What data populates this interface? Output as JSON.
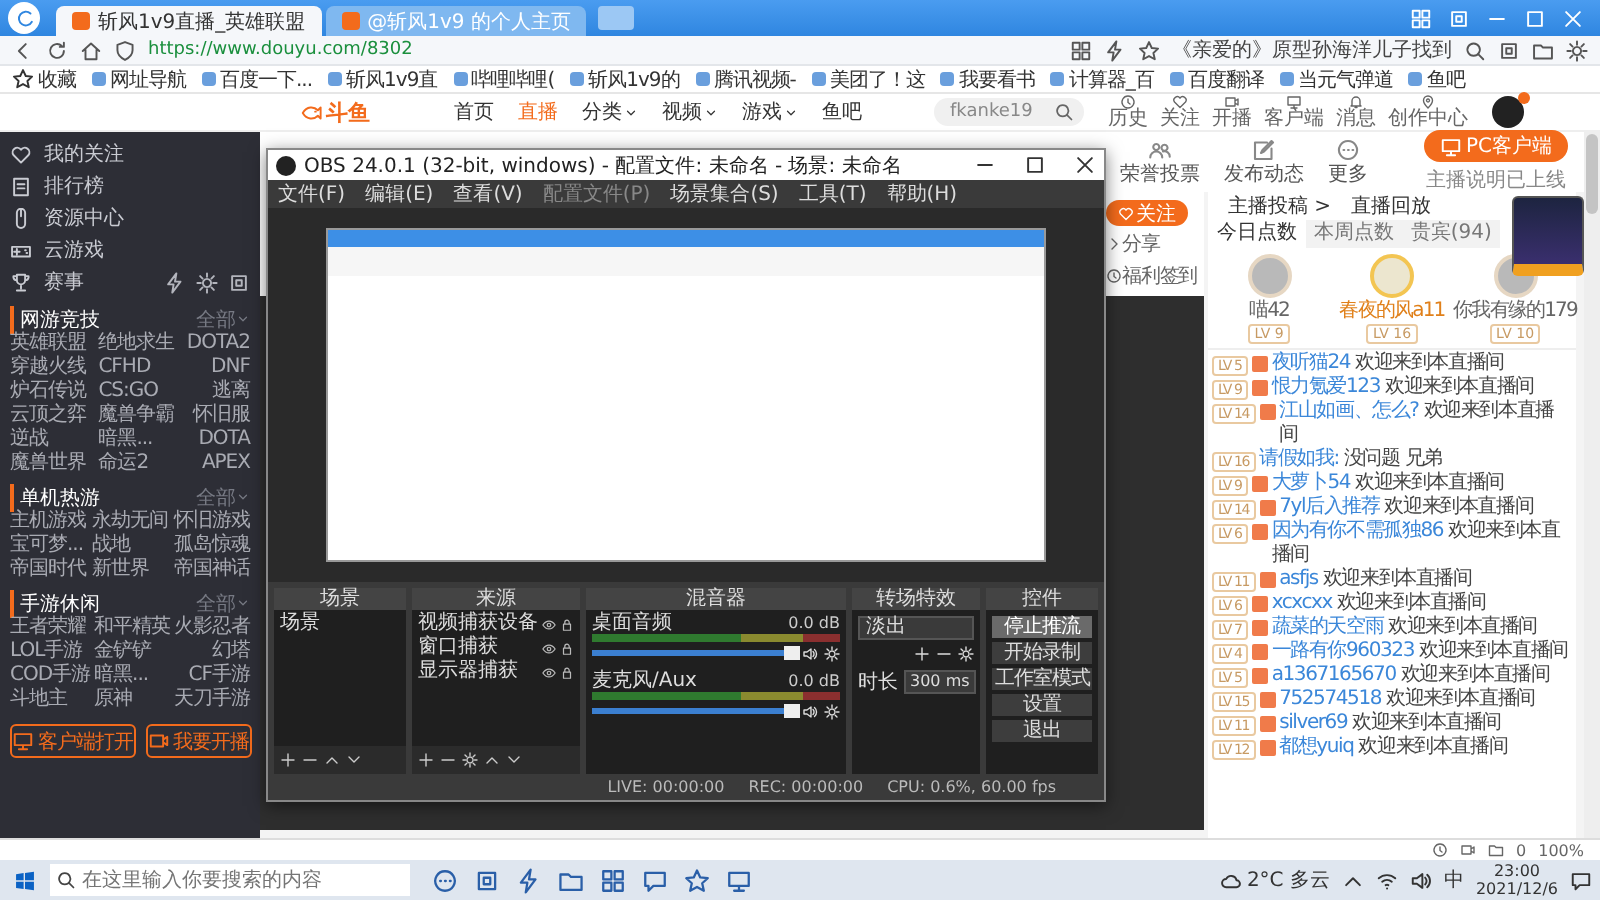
{
  "browser": {
    "tabs": [
      {
        "label": "斩风1v9直播_英雄联盟",
        "selected": true
      },
      {
        "label": "@斩风1v9 的个人主页",
        "selected": false
      }
    ],
    "url": "https://www.douyu.com/8302",
    "headline": "《亲爱的》原型孙海洋儿子找到",
    "bookmarks": [
      "收藏",
      "网址导航",
      "百度一下...",
      "斩风1v9直",
      "哔哩哔哩(",
      "斩风1v9的",
      "腾讯视频-",
      "美团了！这",
      "我要看书",
      "计算器_百",
      "百度翻译",
      "当元气弹道",
      "鱼吧"
    ],
    "status": {
      "count": "0",
      "zoom": "100%"
    }
  },
  "site": {
    "logo": "斗鱼",
    "links": [
      {
        "label": "首页",
        "selected": false,
        "dropdown": false
      },
      {
        "label": "直播",
        "selected": true,
        "dropdown": false
      },
      {
        "label": "分类",
        "selected": false,
        "dropdown": true
      },
      {
        "label": "视频",
        "selected": false,
        "dropdown": true
      },
      {
        "label": "游戏",
        "selected": false,
        "dropdown": true
      },
      {
        "label": "鱼吧",
        "selected": false,
        "dropdown": false
      }
    ],
    "search": {
      "value": "fkanke19"
    },
    "actions": [
      {
        "label": "历史",
        "kind": "clock"
      },
      {
        "label": "关注",
        "kind": "heart"
      },
      {
        "label": "开播",
        "kind": "camera"
      },
      {
        "label": "客户端",
        "kind": "monitor"
      },
      {
        "label": "消息",
        "kind": "bell"
      },
      {
        "label": "创作中心",
        "kind": "pin"
      }
    ]
  },
  "sidebar": {
    "items": [
      {
        "label": "我的关注",
        "kind": "heart"
      },
      {
        "label": "排行榜",
        "kind": "list"
      },
      {
        "label": "资源中心",
        "kind": "mouse"
      },
      {
        "label": "云游戏",
        "kind": "gamepad"
      },
      {
        "label": "赛事",
        "kind": "trophy"
      }
    ],
    "sections": [
      {
        "title": "网游竞技",
        "more": "全部",
        "games": [
          "英雄联盟",
          "绝地求生",
          "DOTA2",
          "穿越火线",
          "CFHD",
          "DNF",
          "炉石传说",
          "CS:GO",
          "逃离",
          "云顶之弈",
          "魔兽争霸",
          "怀旧服",
          "逆战",
          "暗黑...",
          "DOTA",
          "魔兽世界",
          "命运2",
          "APEX"
        ]
      },
      {
        "title": "单机热游",
        "more": "全部",
        "games": [
          "主机游戏",
          "永劫无间",
          "怀旧游戏",
          "宝可梦...",
          "战地",
          "孤岛惊魂",
          "帝国时代",
          "新世界",
          "帝国神话"
        ]
      },
      {
        "title": "手游休闲",
        "more": "全部",
        "games": [
          "王者荣耀",
          "和平精英",
          "火影忍者",
          "LOL手游",
          "金铲铲",
          "幻塔",
          "COD手游",
          "暗黑...",
          "CF手游",
          "斗地主",
          "原神",
          "天刀手游"
        ]
      }
    ],
    "buttons": [
      {
        "label": "客户端打开",
        "kind": "monitor"
      },
      {
        "label": "我要开播",
        "kind": "camera"
      }
    ]
  },
  "room": {
    "tools": [
      {
        "label": "荣誉投票",
        "kind": "users"
      },
      {
        "label": "发布动态",
        "kind": "edit"
      },
      {
        "label": "更多",
        "kind": "more"
      }
    ],
    "client_button": "PC客户端",
    "client_note": "主播说明已上线",
    "follow": "关注",
    "share": "分享",
    "checkin": "福利签到"
  },
  "panel": {
    "links": [
      "主播投稿 >",
      "直播回放"
    ],
    "tabs": [
      {
        "label": "今日点数",
        "selected": true
      },
      {
        "label": "本周点数",
        "selected": false
      },
      {
        "label": "贵宾(94)",
        "selected": false
      }
    ],
    "top": [
      {
        "name": "喵42",
        "level": "LV 9"
      },
      {
        "name": "春夜的风a11",
        "level": "LV 16"
      },
      {
        "name": "你我有缘的179",
        "level": "LV 10"
      }
    ],
    "chat": [
      {
        "kind": "welcome",
        "level": "LV 5",
        "name": "夜听猫24",
        "text": "欢迎来到本直播间"
      },
      {
        "kind": "welcome",
        "level": "LV 9",
        "name": "恨力氪爱123",
        "text": "欢迎来到本直播间"
      },
      {
        "kind": "welcome",
        "level": "LV 14",
        "name": "江山如画、怎么?",
        "text": "欢迎来到本直播间"
      },
      {
        "kind": "message",
        "level": "LV 16",
        "name": "请假如我:",
        "text": "没问题 兄弟"
      },
      {
        "kind": "welcome",
        "level": "LV 9",
        "name": "大萝卜54",
        "text": "欢迎来到本直播间"
      },
      {
        "kind": "welcome",
        "level": "LV 14",
        "name": "7yl后入推荐",
        "text": "欢迎来到本直播间"
      },
      {
        "kind": "welcome",
        "level": "LV 6",
        "name": "因为有你不需孤独86",
        "text": "欢迎来到本直播间"
      },
      {
        "kind": "welcome",
        "level": "LV 11",
        "name": "asfjs",
        "text": "欢迎来到本直播间"
      },
      {
        "kind": "welcome",
        "level": "LV 6",
        "name": "xcxcxx",
        "text": "欢迎来到本直播间"
      },
      {
        "kind": "welcome",
        "level": "LV 7",
        "name": "蔬菜的天空雨",
        "text": "欢迎来到本直播间"
      },
      {
        "kind": "welcome",
        "level": "LV 4",
        "name": "一路有你960323",
        "text": "欢迎来到本直播间"
      },
      {
        "kind": "welcome",
        "level": "LV 5",
        "name": "a1367165670",
        "text": "欢迎来到本直播间"
      },
      {
        "kind": "welcome",
        "level": "LV 15",
        "name": "752574518",
        "text": "欢迎来到本直播间"
      },
      {
        "kind": "welcome",
        "level": "LV 11",
        "name": "silver69",
        "text": "欢迎来到本直播间"
      },
      {
        "kind": "welcome",
        "level": "LV 12",
        "name": "都想yuiq",
        "text": "欢迎来到本直播间"
      }
    ]
  },
  "obs": {
    "title": "OBS 24.0.1 (32-bit, windows) - 配置文件: 未命名 - 场景: 未命名",
    "menu": [
      {
        "label": "文件(F)",
        "disabled": false
      },
      {
        "label": "编辑(E)",
        "disabled": false
      },
      {
        "label": "查看(V)",
        "disabled": false
      },
      {
        "label": "配置文件(P)",
        "disabled": true
      },
      {
        "label": "场景集合(S)",
        "disabled": false
      },
      {
        "label": "工具(T)",
        "disabled": false
      },
      {
        "label": "帮助(H)",
        "disabled": false
      }
    ],
    "scenes": {
      "title": "场景",
      "items": [
        "场景"
      ]
    },
    "sources": {
      "title": "来源",
      "items": [
        "视频捕获设备",
        "窗口捕获",
        "显示器捕获"
      ]
    },
    "mixer": {
      "title": "混音器",
      "channels": [
        {
          "name": "桌面音频",
          "reading": "0.0 dB",
          "level": 0.97
        },
        {
          "name": "麦克风/Aux",
          "reading": "0.0 dB",
          "level": 0.97
        }
      ]
    },
    "transitions": {
      "title": "转场特效",
      "selected": "淡出",
      "duration_label": "时长",
      "duration": "300 ms"
    },
    "controls": {
      "title": "控件",
      "buttons": [
        {
          "label": "停止推流",
          "active": true
        },
        {
          "label": "开始录制",
          "active": false
        },
        {
          "label": "工作室模式",
          "active": false
        },
        {
          "label": "设置",
          "active": false
        },
        {
          "label": "退出",
          "active": false
        }
      ]
    },
    "status": {
      "live": "LIVE: 00:00:00",
      "rec": "REC: 00:00:00",
      "cpu": "CPU: 0.6%, 60.00 fps"
    }
  },
  "taskbar": {
    "search": {
      "placeholder": "在这里输入你要搜索的内容"
    },
    "weather": "2°C 多云",
    "ime": "中",
    "time": "23:00",
    "date": "2021/12/6"
  }
}
